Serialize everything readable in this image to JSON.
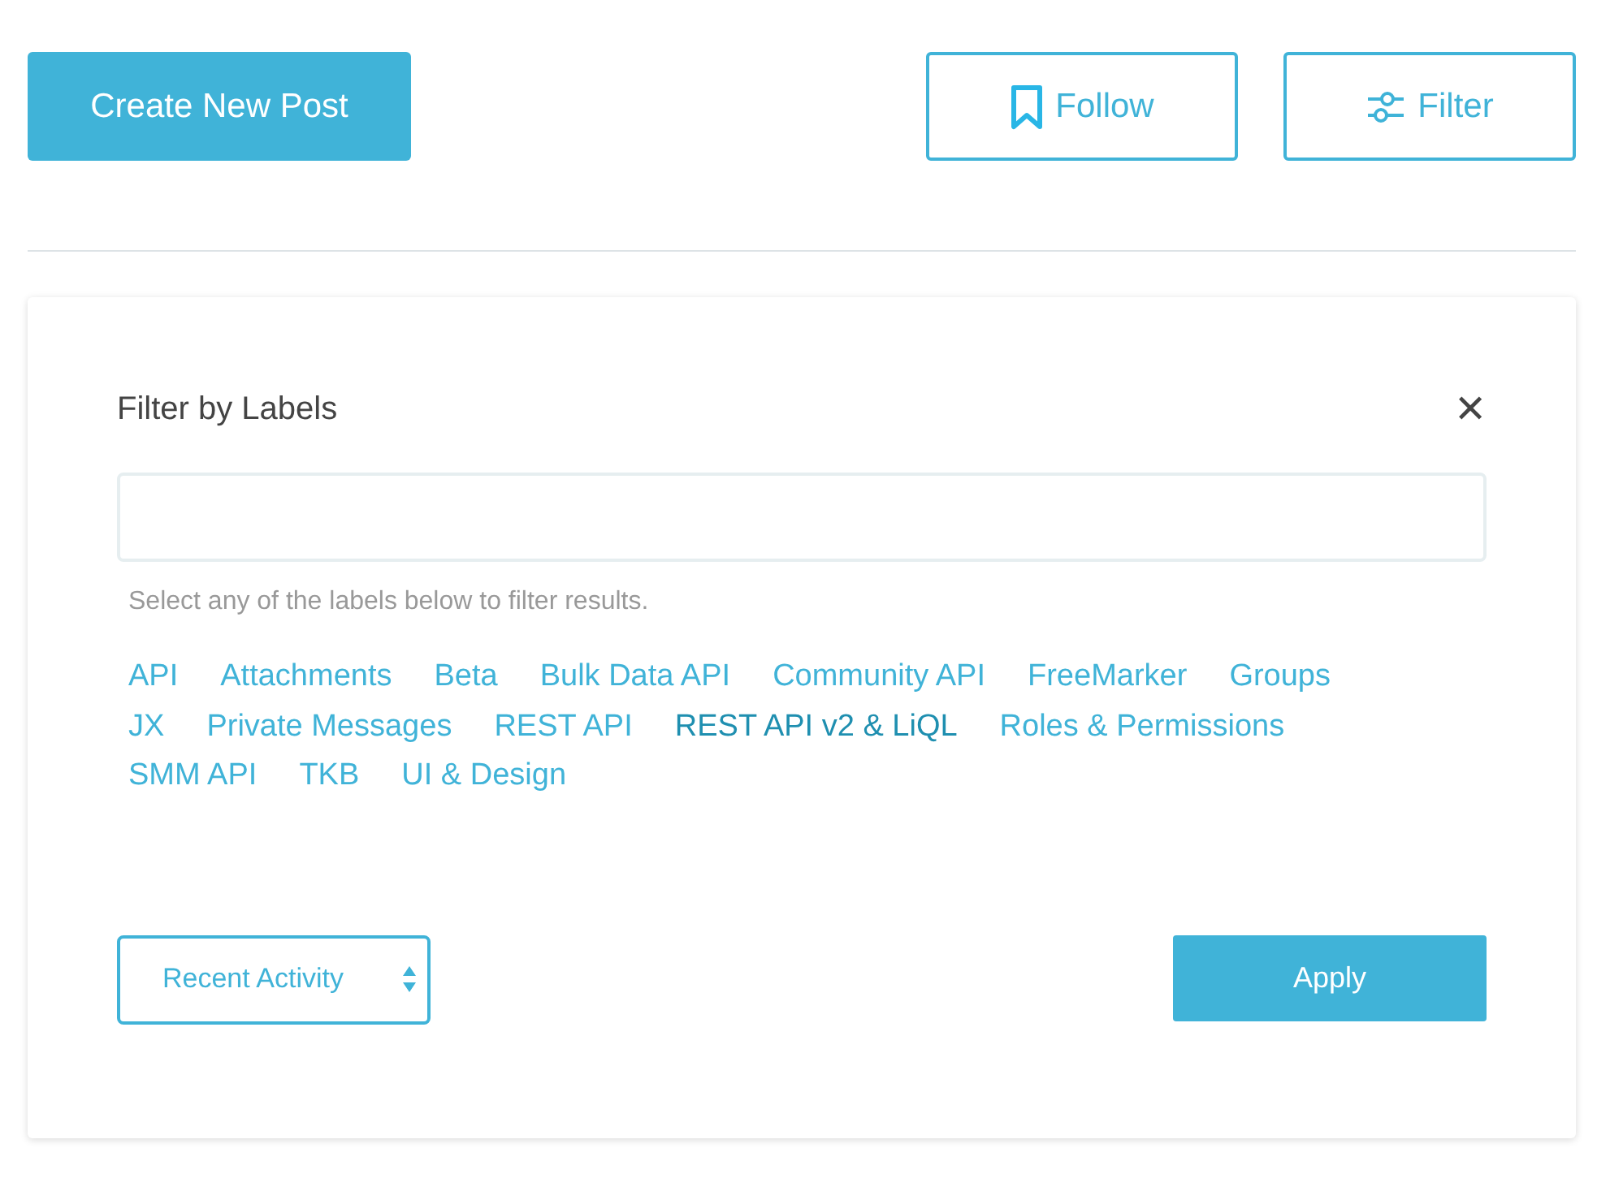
{
  "actions": {
    "create_button": "Create New Post",
    "follow_button": "Follow",
    "filter_button": "Filter"
  },
  "filter_panel": {
    "title": "Filter by Labels",
    "close": "✕",
    "hint": "Select any of the labels below to filter results.",
    "labels": [
      {
        "text": "API",
        "selected": false
      },
      {
        "text": "Attachments",
        "selected": false
      },
      {
        "text": "Beta",
        "selected": false
      },
      {
        "text": "Bulk Data API",
        "selected": false
      },
      {
        "text": "Community API",
        "selected": false
      },
      {
        "text": "FreeMarker",
        "selected": false
      },
      {
        "text": "Groups",
        "selected": false
      },
      {
        "text": "JX",
        "selected": false
      },
      {
        "text": "Private Messages",
        "selected": false
      },
      {
        "text": "REST API",
        "selected": false
      },
      {
        "text": "REST API v2 & LiQL",
        "selected": true
      },
      {
        "text": "Roles & Permissions",
        "selected": false
      },
      {
        "text": "SMM API",
        "selected": false
      },
      {
        "text": "TKB",
        "selected": false
      },
      {
        "text": "UI & Design",
        "selected": false
      }
    ],
    "sort_select": "Recent Activity",
    "apply_button": "Apply"
  }
}
